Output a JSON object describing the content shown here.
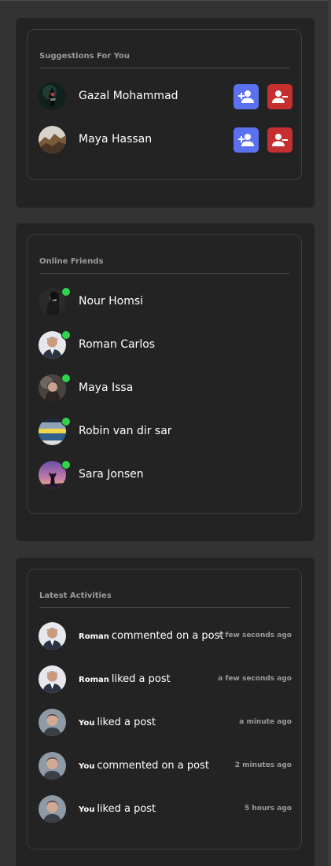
{
  "suggestions": {
    "title": "Suggestions For You",
    "people": [
      {
        "name": "Gazal Mohammad",
        "avatar": "avatar-dark-figure"
      },
      {
        "name": "Maya Hassan",
        "avatar": "avatar-rocky-cliff"
      }
    ],
    "add_icon": "person-add-icon",
    "remove_icon": "person-remove-icon"
  },
  "online": {
    "title": "Online Friends",
    "friends": [
      {
        "name": "Nour Homsi"
      },
      {
        "name": "Roman Carlos"
      },
      {
        "name": "Maya Issa"
      },
      {
        "name": "Robin van dir sar"
      },
      {
        "name": "Sara Jonsen"
      }
    ]
  },
  "activities": {
    "title": "Latest Activities",
    "items": [
      {
        "user": "Roman",
        "action": "commented on a post",
        "time": "a few seconds ago"
      },
      {
        "user": "Roman",
        "action": "liked a post",
        "time": "a few seconds ago"
      },
      {
        "user": "You",
        "action": "liked a post",
        "time": "a minute ago"
      },
      {
        "user": "You",
        "action": "commented on a post",
        "time": "2 minutes ago"
      },
      {
        "user": "You",
        "action": "liked a post",
        "time": "5 hours ago"
      }
    ]
  },
  "colors": {
    "background": "#333333",
    "card": "#232323",
    "add_button": "#5a72f0",
    "remove_button": "#c62f2f",
    "online_dot": "#31d34a",
    "muted_text": "#9b9b9b"
  }
}
